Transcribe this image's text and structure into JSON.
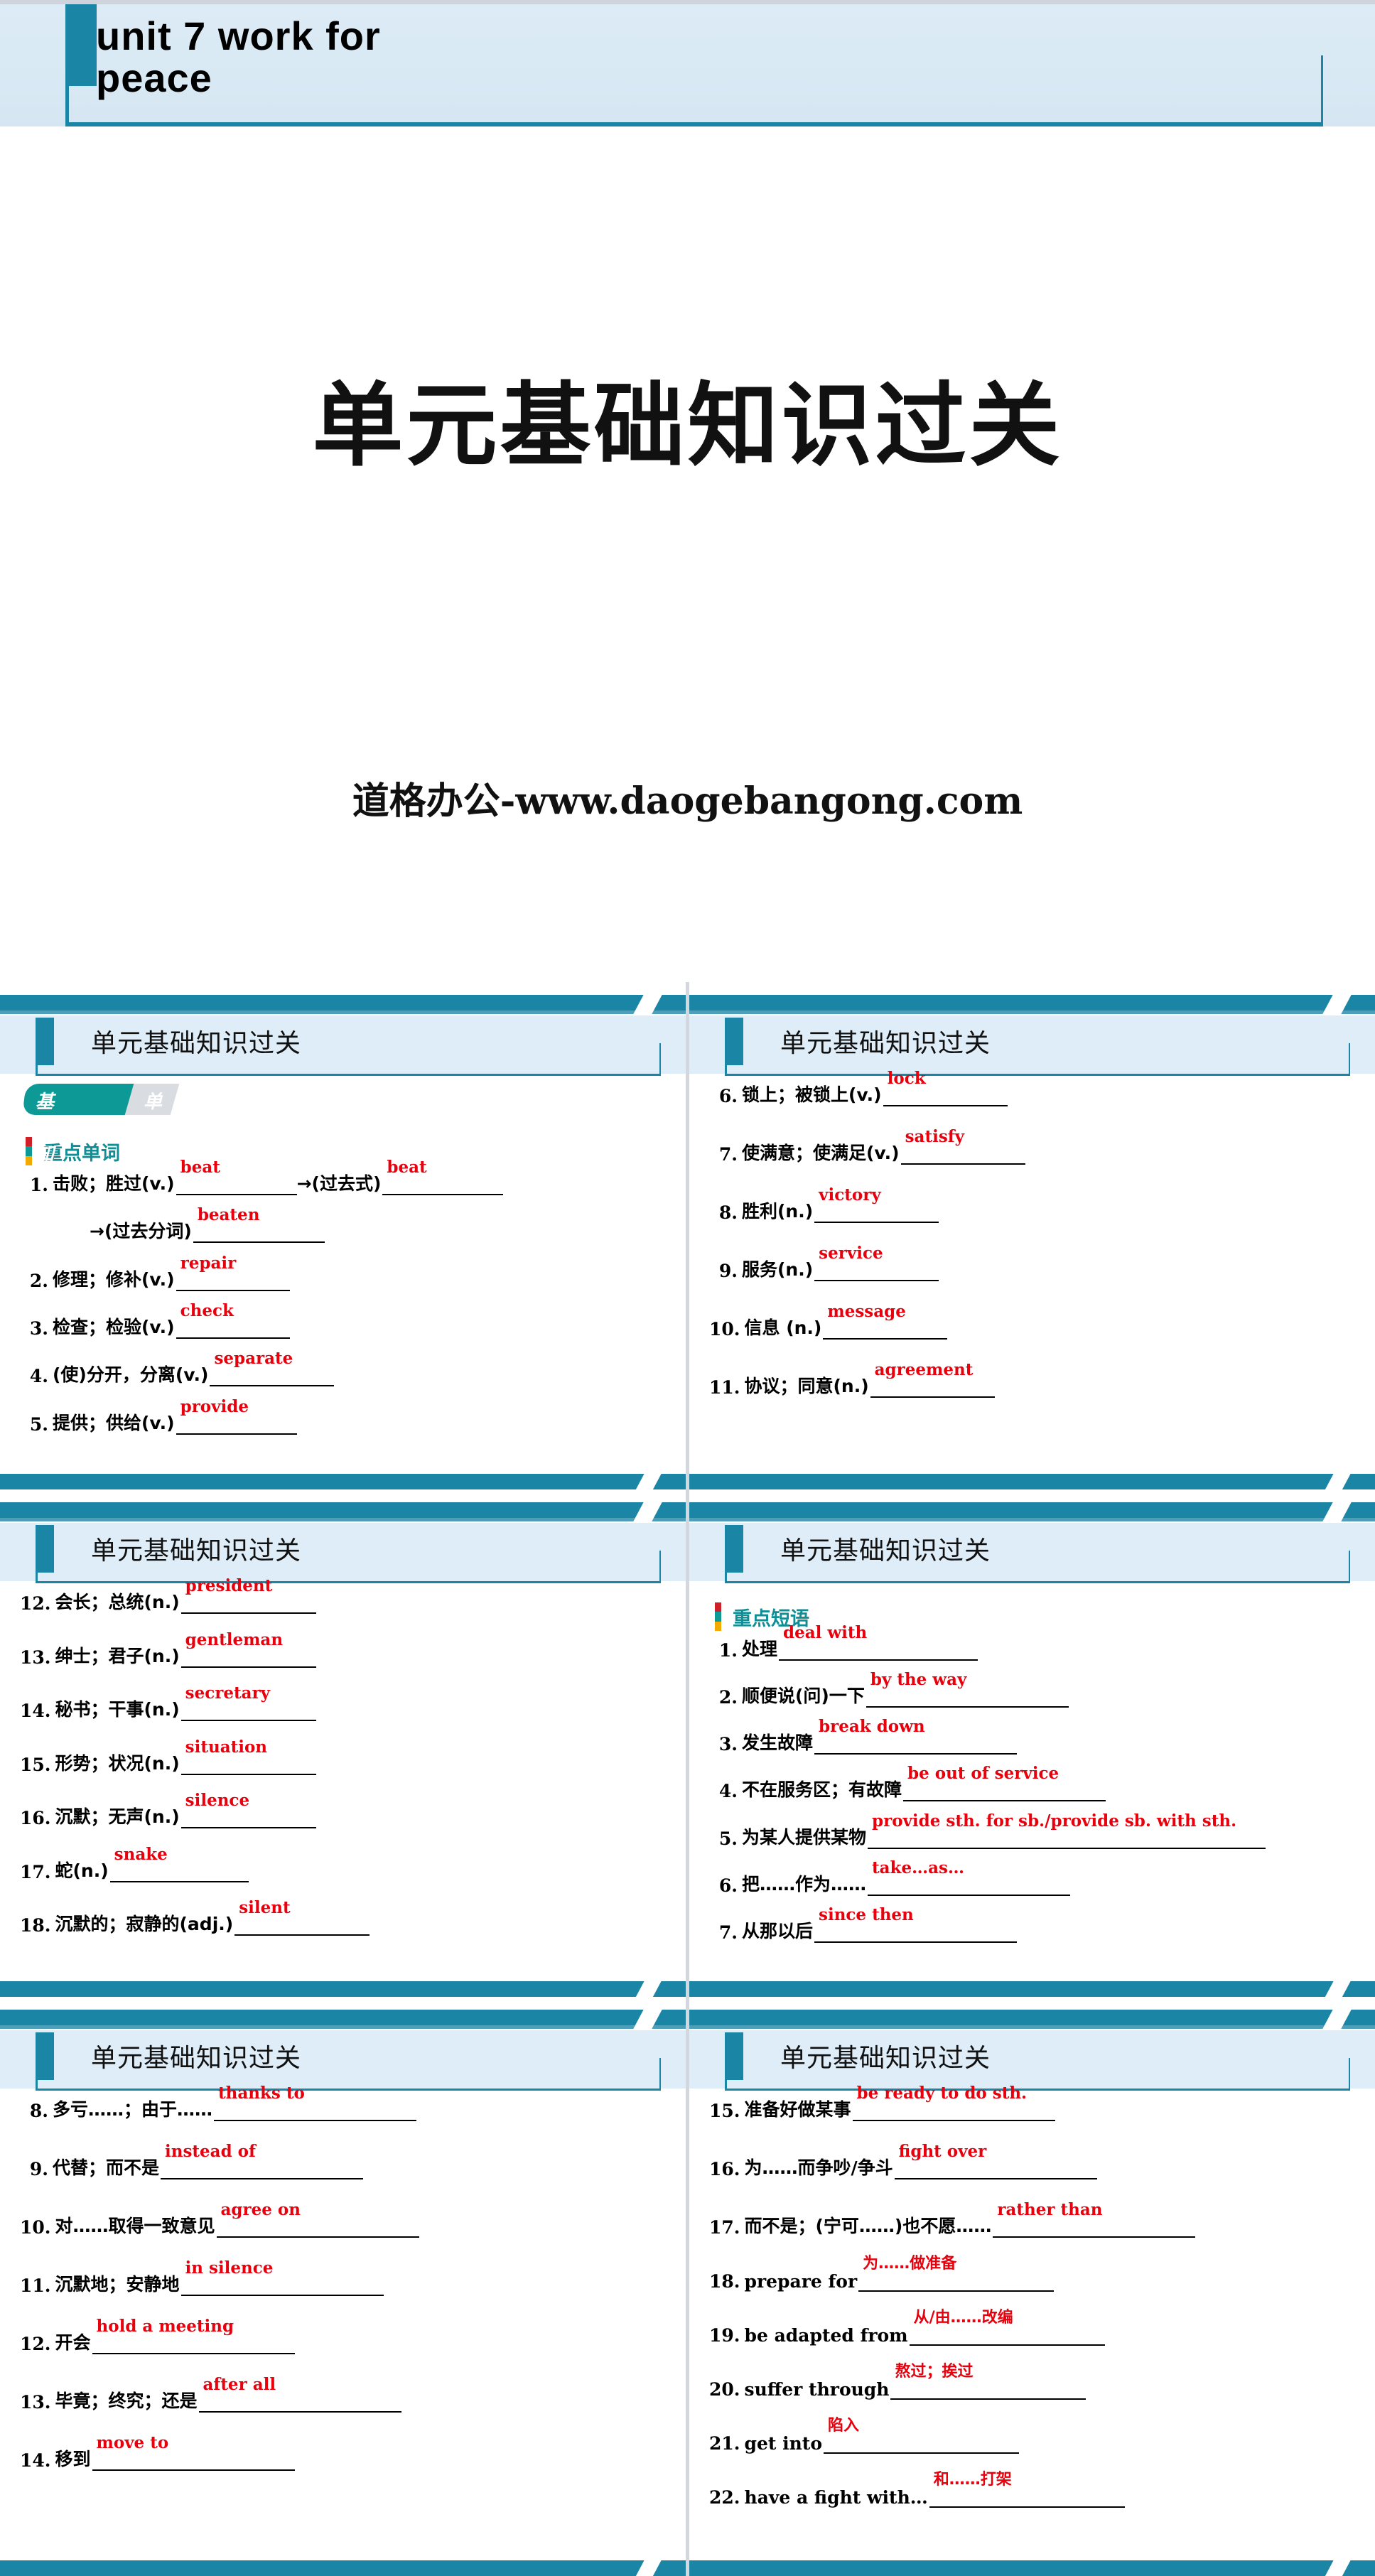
{
  "title_slide": {
    "heading_line1": "unit 7   work  for",
    "heading_line2": "peace",
    "big_title": "单元基础知识过关",
    "watermark": "道格办公-www.daogebangong.com",
    "accent_color": "#1b85a6",
    "band_color": "#dcebf5"
  },
  "slide_header_title": "单元基础知识过关",
  "badge": {
    "part1": "基础知识清",
    "part2": "单"
  },
  "sections": {
    "words": "重点单词",
    "phrases": "重点短语"
  },
  "slides": [
    {
      "id": "slide-1",
      "title": "单元基础知识过关",
      "has_badge": true,
      "section": "重点单词",
      "items": [
        {
          "num": "1.",
          "zh": "击败；胜过(v.)",
          "answer": "beat",
          "blank_w": 170,
          "tail_zh": "→(过去式)",
          "tail_answer": "beat",
          "tail_blank_w": 170
        },
        {
          "num": "",
          "zh": "→(过去分词)",
          "answer": "beaten",
          "blank_w": 185,
          "indent": true
        },
        {
          "num": "2.",
          "zh": "修理；修补(v.)",
          "answer": "repair",
          "blank_w": 160
        },
        {
          "num": "3.",
          "zh": "检查；检验(v.)",
          "answer": "check",
          "blank_w": 160
        },
        {
          "num": "4.",
          "zh": "(使)分开，分离(v.)",
          "answer": "separate",
          "blank_w": 175
        },
        {
          "num": "5.",
          "zh": "提供；供给(v.)",
          "answer": "provide",
          "blank_w": 170
        }
      ]
    },
    {
      "id": "slide-2",
      "title": "单元基础知识过关",
      "has_badge": false,
      "items": [
        {
          "num": "6.",
          "zh": "锁上；被锁上(v.)",
          "answer": "lock",
          "blank_w": 175
        },
        {
          "num": "7.",
          "zh": "使满意；使满足(v.)",
          "answer": "satisfy",
          "blank_w": 175
        },
        {
          "num": "8.",
          "zh": "胜利(n.)",
          "answer": "victory",
          "blank_w": 175
        },
        {
          "num": "9.",
          "zh": "服务(n.)",
          "answer": "service",
          "blank_w": 175
        },
        {
          "num": "10.",
          "zh": "信息 (n.)",
          "answer": "message",
          "blank_w": 175
        },
        {
          "num": "11.",
          "zh": "协议；同意(n.)",
          "answer": "agreement",
          "blank_w": 175
        }
      ]
    },
    {
      "id": "slide-3",
      "title": "单元基础知识过关",
      "has_badge": false,
      "items": [
        {
          "num": "12.",
          "zh": "会长；总统(n.)",
          "answer": "president",
          "blank_w": 190
        },
        {
          "num": "13.",
          "zh": "绅士；君子(n.)",
          "answer": "gentleman",
          "blank_w": 190
        },
        {
          "num": "14.",
          "zh": "秘书；干事(n.)",
          "answer": "secretary",
          "blank_w": 190
        },
        {
          "num": "15.",
          "zh": "形势；状况(n.)",
          "answer": "situation",
          "blank_w": 190
        },
        {
          "num": "16.",
          "zh": "沉默；无声(n.)",
          "answer": "silence",
          "blank_w": 190
        },
        {
          "num": "17.",
          "zh": "蛇(n.)",
          "answer": "snake",
          "blank_w": 195
        },
        {
          "num": "18.",
          "zh": "沉默的；寂静的(adj.)",
          "answer": "silent",
          "blank_w": 190
        }
      ]
    },
    {
      "id": "slide-4",
      "title": "单元基础知识过关",
      "has_badge": false,
      "section": "重点短语",
      "items": [
        {
          "num": "1.",
          "zh": "处理",
          "answer": "deal with",
          "blank_w": 280
        },
        {
          "num": "2.",
          "zh": "顺便说(问)一下",
          "answer": "by the way",
          "blank_w": 285
        },
        {
          "num": "3.",
          "zh": "发生故障 ",
          "answer": "break down",
          "blank_w": 285
        },
        {
          "num": "4.",
          "zh": "不在服务区；有故障 ",
          "answer": "be out of service",
          "blank_w": 285
        },
        {
          "num": "5.",
          "zh": "为某人提供某物",
          "answer": "provide sth. for  sb./provide sb. with sth.",
          "blank_w": 560
        },
        {
          "num": "6.",
          "zh": "把……作为…… ",
          "answer": "take…as…",
          "blank_w": 285
        },
        {
          "num": "7.",
          "zh": "从那以后",
          "answer": "since then",
          "blank_w": 285
        }
      ]
    },
    {
      "id": "slide-5",
      "title": "单元基础知识过关",
      "has_badge": false,
      "items": [
        {
          "num": "8.",
          "zh": "多亏……；由于……",
          "answer": "thanks to",
          "blank_w": 285
        },
        {
          "num": "9.",
          "zh": "代替；而不是",
          "answer": "instead of",
          "blank_w": 285
        },
        {
          "num": "10.",
          "zh": "对……取得一致意见 ",
          "answer": "agree on",
          "blank_w": 285
        },
        {
          "num": "11.",
          "zh": "沉默地；安静地",
          "answer": "in silence",
          "blank_w": 285
        },
        {
          "num": "12.",
          "zh": "开会",
          "answer": "hold a meeting",
          "blank_w": 285
        },
        {
          "num": "13.",
          "zh": "毕竟；终究；还是",
          "answer": "after all",
          "blank_w": 285
        },
        {
          "num": "14.",
          "zh": "移到 ",
          "answer": "move to",
          "blank_w": 285
        }
      ]
    },
    {
      "id": "slide-6",
      "title": "单元基础知识过关",
      "has_badge": false,
      "items": [
        {
          "num": "15.",
          "zh": "准备好做某事",
          "answer": "be ready to do sth.",
          "blank_w": 285
        },
        {
          "num": "16.",
          "zh": "为……而争吵/争斗 ",
          "answer": "fight over",
          "blank_w": 285
        },
        {
          "num": "17.",
          "zh": "而不是；(宁可……)也不愿……",
          "answer": "rather than",
          "blank_w": 285
        },
        {
          "num": "18.",
          "en": "prepare for ",
          "answer": "为……做准备",
          "answer_zh": true,
          "blank_w": 275
        },
        {
          "num": "19.",
          "en": "be adapted from ",
          "answer": "从/由……改编",
          "answer_zh": true,
          "blank_w": 275
        },
        {
          "num": "20.",
          "en": "suffer through",
          "answer": "熬过；挨过",
          "answer_zh": true,
          "blank_w": 275
        },
        {
          "num": "21.",
          "en": "get into ",
          "answer": "陷入",
          "answer_zh": true,
          "blank_w": 275
        },
        {
          "num": "22.",
          "en": "have a fight with…",
          "answer": "和……打架",
          "answer_zh": true,
          "blank_w": 275
        }
      ]
    }
  ]
}
